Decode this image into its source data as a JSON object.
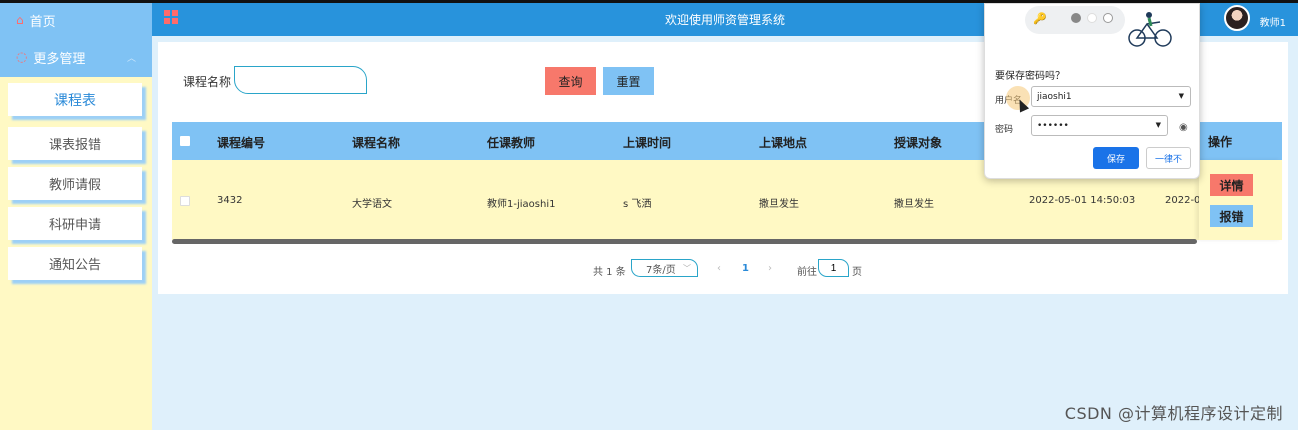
{
  "header": {
    "title": "欢迎使用师资管理系统",
    "username": "教师1"
  },
  "sidebar": {
    "home": "首页",
    "more": "更多管理",
    "items": [
      {
        "label": "课程表",
        "active": true
      },
      {
        "label": "课表报错"
      },
      {
        "label": "教师请假"
      },
      {
        "label": "科研申请"
      },
      {
        "label": "通知公告"
      }
    ]
  },
  "search": {
    "label": "课程名称",
    "value": "",
    "search_button": "查询",
    "reset_button": "重置"
  },
  "table": {
    "columns": [
      "课程编号",
      "课程名称",
      "任课教师",
      "上课时间",
      "上课地点",
      "授课对象",
      "",
      "",
      "操作"
    ],
    "rows": [
      {
        "course_no": "3432",
        "course_name": "大学语文",
        "teacher": "教师1-jiaoshi1",
        "time": "s 飞洒",
        "location": "撒旦发生",
        "audience": "撒旦发生",
        "created": "2022-05-01 14:50:03",
        "extra": "2022-05-",
        "detail_button": "详情",
        "report_button": "报错"
      }
    ]
  },
  "pager": {
    "total": "共 1 条",
    "page_size": "7条/页",
    "prev": "‹",
    "current": "1",
    "next": "›",
    "goto": "前往",
    "goto_value": "1",
    "unit": "页"
  },
  "password_popup": {
    "title": "要保存密码吗？",
    "username_label": "用户名",
    "username_value": "jiaoshi1",
    "password_label": "密码",
    "password_value": "••••••",
    "save_button": "保存",
    "never_button": "一律不"
  },
  "watermark": "CSDN @计算机程序设计定制"
}
